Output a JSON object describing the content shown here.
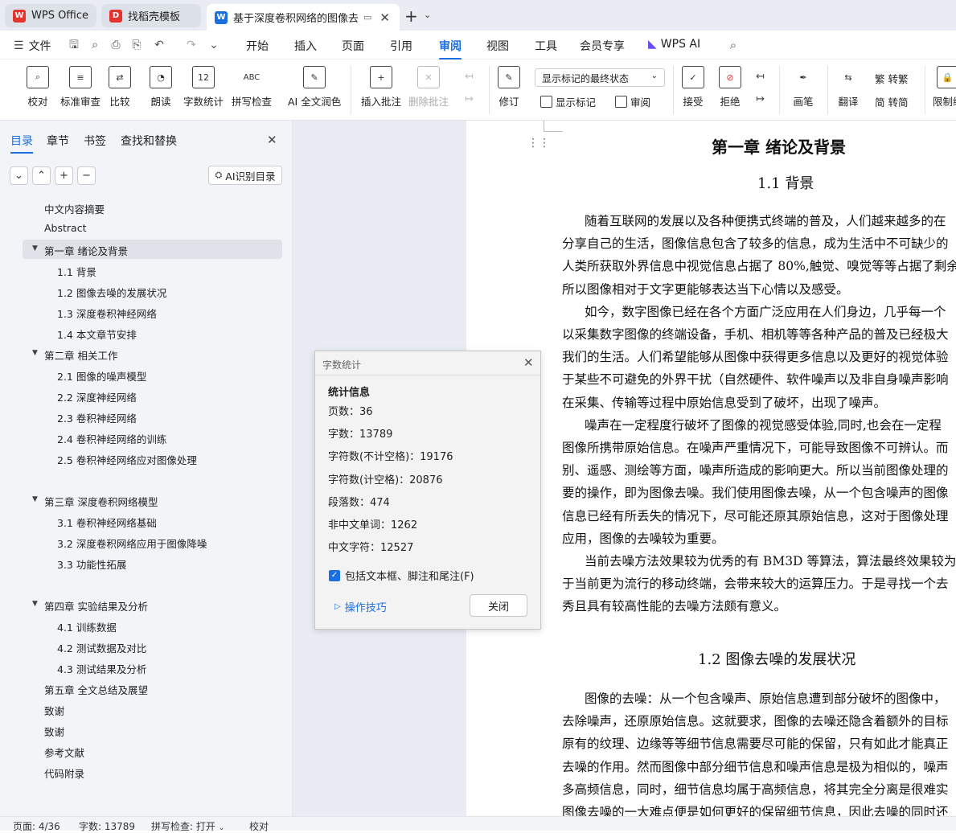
{
  "tabs": [
    {
      "label": "WPS Office",
      "icon": "wps-logo-icon",
      "color": "#e3342f"
    },
    {
      "label": "找稻壳模板",
      "icon": "docer-icon",
      "color": "#e3342f"
    },
    {
      "label": "基于深度卷积网络的图像去噪",
      "icon": "wps-writer-icon",
      "color": "#1c6fe0"
    }
  ],
  "menu": {
    "file": "文件",
    "items": [
      "开始",
      "插入",
      "页面",
      "引用",
      "审阅",
      "视图",
      "工具",
      "会员专享"
    ],
    "active": "审阅",
    "wps_ai": "WPS AI"
  },
  "ribbon": {
    "proofread": "校对",
    "std_review": "标准审查",
    "compare": "比较",
    "read_aloud": "朗读",
    "word_count": "字数统计",
    "spell_check": "拼写检查",
    "ai_polish": "AI 全文润色",
    "insert_comment": "插入批注",
    "delete_comment": "删除批注",
    "revise": "修订",
    "markup_select": "显示标记的最终状态",
    "show_markup": "显示标记",
    "review": "审阅",
    "accept": "接受",
    "reject": "拒绝",
    "pen": "画笔",
    "translate": "翻译",
    "to_traditional": "转繁",
    "to_simplified": "转简",
    "restrict": "限制编"
  },
  "panel": {
    "tabs": [
      "目录",
      "章节",
      "书签",
      "查找和替换"
    ],
    "ai_toc": "AI识别目录",
    "toc": [
      {
        "text": "中文内容摘要",
        "level": 1,
        "arrow": false
      },
      {
        "text": "Abstract",
        "level": 1,
        "arrow": false
      },
      {
        "text": "第一章  绪论及背景",
        "level": 1,
        "arrow": true,
        "selected": true
      },
      {
        "text": "1.1 背景",
        "level": 2
      },
      {
        "text": "1.2  图像去噪的发展状况",
        "level": 2
      },
      {
        "text": "1.3  深度卷积神经网络",
        "level": 2
      },
      {
        "text": "1.4  本文章节安排",
        "level": 2
      },
      {
        "text": "第二章  相关工作",
        "level": 1,
        "arrow": true
      },
      {
        "text": "2.1 图像的噪声模型",
        "level": 2
      },
      {
        "text": "2.2 深度神经网络",
        "level": 2
      },
      {
        "text": "2.3 卷积神经网络",
        "level": 2
      },
      {
        "text": "2.4  卷积神经网络的训练",
        "level": 2
      },
      {
        "text": "2.5  卷积神经网络应对图像处理",
        "level": 2
      },
      {
        "text": "",
        "level": 0
      },
      {
        "text": "第三章  深度卷积网络模型",
        "level": 1,
        "arrow": true
      },
      {
        "text": "3.1  卷积神经网络基础",
        "level": 2
      },
      {
        "text": "3.2  深度卷积网络应用于图像降噪",
        "level": 2
      },
      {
        "text": "3.3  功能性拓展",
        "level": 2
      },
      {
        "text": "",
        "level": 0
      },
      {
        "text": "第四章  实验结果及分析",
        "level": 1,
        "arrow": true
      },
      {
        "text": "4.1  训练数据",
        "level": 2
      },
      {
        "text": "4.2  测试数据及对比",
        "level": 2
      },
      {
        "text": "4.3  测试结果及分析",
        "level": 2
      },
      {
        "text": "第五章  全文总结及展望",
        "level": 1
      },
      {
        "text": "致谢",
        "level": 1
      },
      {
        "text": "致谢",
        "level": 1
      },
      {
        "text": "参考文献",
        "level": 1
      },
      {
        "text": "代码附录",
        "level": 1
      }
    ]
  },
  "document": {
    "chapter_title": "第一章  绪论及背景",
    "section1_title": "1.1  背景",
    "section2_title": "1.2  图像去噪的发展状况",
    "lines1": [
      "随着互联网的发展以及各种便携式终端的普及，人们越来越多的在",
      "分享自己的生活，图像信息包含了较多的信息，成为生活中不可缺少的",
      "人类所获取外界信息中视觉信息占据了 80%,触觉、嗅觉等等占据了剩余",
      "所以图像相对于文字更能够表达当下心情以及感受。",
      "如今，数字图像已经在各个方面广泛应用在人们身边，几乎每一个",
      "以采集数字图像的终端设备，手机、相机等等各种产品的普及已经极大",
      "我们的生活。人们希望能够从图像中获得更多信息以及更好的视觉体验",
      "于某些不可避免的外界干扰（自然硬件、软件噪声以及非自身噪声影响",
      "在采集、传输等过程中原始信息受到了破坏，出现了噪声。",
      "噪声在一定程度行破坏了图像的视觉感受体验,同时,也会在一定程",
      "图像所携带原始信息。在噪声严重情况下，可能导致图像不可辨认。而",
      "别、遥感、测绘等方面，噪声所造成的影响更大。所以当前图像处理的",
      "要的操作，即为图像去噪。我们使用图像去噪，从一个包含噪声的图像",
      "信息已经有所丢失的情况下，尽可能还原其原始信息，这对于图像处理",
      "应用，图像的去噪较为重要。",
      "当前去噪方法效果较为优秀的有 BM3D 等算法，算法最终效果较为",
      "于当前更为流行的移动终端，会带来较大的运算压力。于是寻找一个去",
      "秀且具有较高性能的去噪方法颇有意义。"
    ],
    "lines2": [
      "图像的去噪：从一个包含噪声、原始信息遭到部分破坏的图像中，",
      "去除噪声，还原原始信息。这就要求，图像的去噪还隐含着额外的目标",
      "原有的纹理、边缘等等细节信息需要尽可能的保留，只有如此才能真正",
      "去噪的作用。然而图像中部分细节信息和噪声信息是极为相似的，噪声",
      "多高频信息，同时，细节信息均属于高频信息，将其完全分离是很难实",
      "图像去噪的一大难点便是如何更好的保留细节信息，因此去噪的同时还"
    ]
  },
  "dialog": {
    "title": "字数统计",
    "section": "统计信息",
    "stats": [
      "页数：36",
      "字数：13789",
      "字符数(不计空格)：19176",
      "字符数(计空格)：20876",
      "段落数：474",
      "非中文单词：1262",
      "中文字符：12527"
    ],
    "checkbox": "包括文本框、脚注和尾注(F)",
    "tips": "操作技巧",
    "close": "关闭"
  },
  "status": {
    "page": "页面: 4/36",
    "words": "字数: 13789",
    "spell": "拼写检查: 打开",
    "proof": "校对"
  }
}
